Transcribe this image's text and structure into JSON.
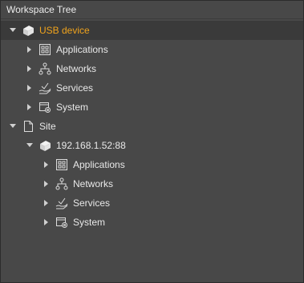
{
  "panel": {
    "title": "Workspace Tree"
  },
  "colors": {
    "accent": "#f0a31c",
    "background": "#484848",
    "text": "#e8e8e8"
  },
  "tree": {
    "usb_device": {
      "label": "USB device",
      "icon": "device-icon",
      "expanded": true,
      "children": [
        {
          "label": "Applications",
          "icon": "applications-icon"
        },
        {
          "label": "Networks",
          "icon": "networks-icon"
        },
        {
          "label": "Services",
          "icon": "services-icon"
        },
        {
          "label": "System",
          "icon": "system-icon"
        }
      ]
    },
    "site": {
      "label": "Site",
      "icon": "document-icon",
      "expanded": true,
      "device": {
        "label": "192.168.1.52:88",
        "icon": "device-icon",
        "expanded": true,
        "children": [
          {
            "label": "Applications",
            "icon": "applications-icon"
          },
          {
            "label": "Networks",
            "icon": "networks-icon"
          },
          {
            "label": "Services",
            "icon": "services-icon"
          },
          {
            "label": "System",
            "icon": "system-icon"
          }
        ]
      }
    }
  }
}
